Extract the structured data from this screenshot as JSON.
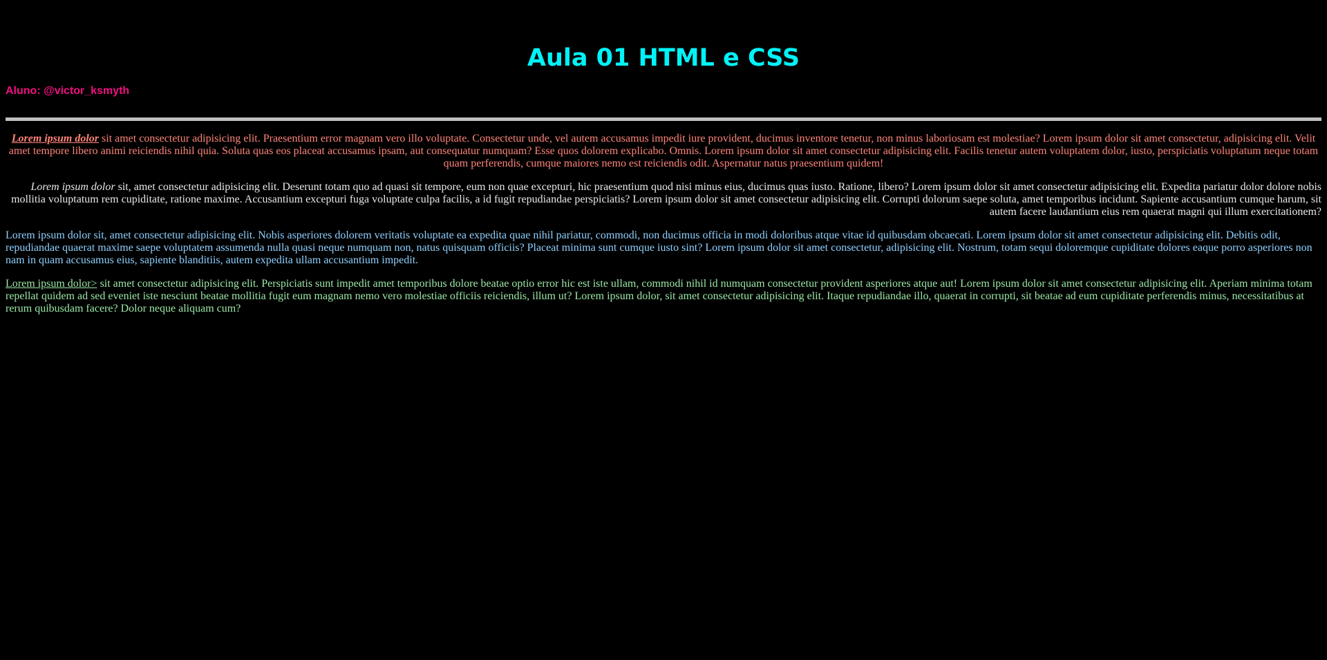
{
  "header": {
    "title": "Aula 01 HTML e CSS",
    "student": "Aluno: @victor_ksmyth"
  },
  "paragraphs": [
    {
      "lead": "Lorem ipsum dolor",
      "text": " sit amet consectetur adipisicing elit. Praesentium error magnam vero illo voluptate. Consectetur unde, vel autem accusamus impedit iure provident, ducimus inventore tenetur, non minus laboriosam est molestiae? Lorem ipsum dolor sit amet consectetur, adipisicing elit. Velit amet tempore libero animi reiciendis nihil quia. Soluta quas eos placeat accusamus ipsam, aut consequatur numquam? Esse quos dolorem explicabo. Omnis. Lorem ipsum dolor sit amet consectetur adipisicing elit. Facilis tenetur autem voluptatem dolor, iusto, perspiciatis voluptatum neque totam quam perferendis, cumque maiores nemo est reiciendis odit. Aspernatur natus praesentium quidem!"
    },
    {
      "lead": "Lorem ipsum dolor",
      "text": " sit, amet consectetur adipisicing elit. Deserunt totam quo ad quasi sit tempore, eum non quae excepturi, hic praesentium quod nisi minus eius, ducimus quas iusto. Ratione, libero? Lorem ipsum dolor sit amet consectetur adipisicing elit. Expedita pariatur dolor dolore nobis mollitia voluptatum rem cupiditate, ratione maxime. Accusantium excepturi fuga voluptate culpa facilis, a id fugit repudiandae perspiciatis? Lorem ipsum dolor sit amet consectetur adipisicing elit. Corrupti dolorum saepe soluta, amet temporibus incidunt. Sapiente accusantium cumque harum, sit autem facere laudantium eius rem quaerat magni qui illum exercitationem?"
    },
    {
      "text": "Lorem ipsum dolor sit, amet consectetur adipisicing elit. Nobis asperiores dolorem veritatis voluptate ea expedita quae nihil pariatur, commodi, non ducimus officia in modi doloribus atque vitae id quibusdam obcaecati. Lorem ipsum dolor sit amet consectetur adipisicing elit. Debitis odit, repudiandae quaerat maxime saepe voluptatem assumenda nulla quasi neque numquam non, natus quisquam officiis? Placeat minima sunt cumque iusto sint? Lorem ipsum dolor sit amet consectetur, adipisicing elit. Nostrum, totam sequi doloremque cupiditate dolores eaque porro asperiores non nam in quam accusamus eius, sapiente blanditiis, autem expedita ullam accusantium impedit."
    },
    {
      "lead": "Lorem ipsum dolor>",
      "text": " sit amet consectetur adipisicing elit. Perspiciatis sunt impedit amet temporibus dolore beatae optio error hic est iste ullam, commodi nihil id numquam consectetur provident asperiores atque aut! Lorem ipsum dolor sit amet consectetur adipisicing elit. Aperiam minima totam repellat quidem ad sed eveniet iste nesciunt beatae mollitia fugit eum magnam nemo vero molestiae officiis reiciendis, illum ut? Lorem ipsum dolor, sit amet consectetur adipisicing elit. Itaque repudiandae illo, quaerat in corrupti, sit beatae ad eum cupiditate perferendis minus, necessitatibus at rerum quibusdam facere? Dolor neque aliquam cum?"
    }
  ],
  "colors": {
    "background": "#000000",
    "title": "#00f3f7",
    "student": "#f00f82",
    "divider": "#c0c0c0",
    "paragraph_1": "#ff8479",
    "paragraph_2": "#e8e8e8",
    "paragraph_3": "#8fd0ff",
    "paragraph_4": "#9be7a6"
  }
}
